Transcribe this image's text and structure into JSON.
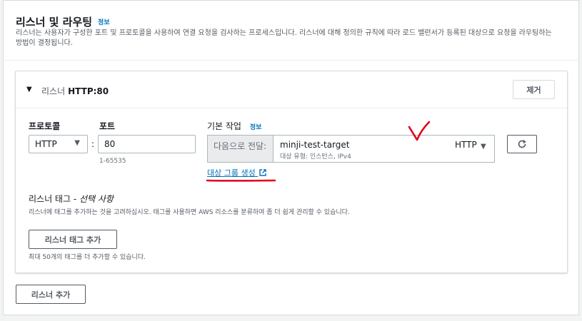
{
  "section": {
    "title": "리스너 및 라우팅",
    "info": "정보",
    "description": "리스너는 사용자가 구성한 포트 및 프로토콜을 사용하여 연결 요청을 검사하는 프로세스입니다. 리스너에 대해 정의한 규칙에 따라 로드 밸런서가 등록된 대상으로 요청을 라우팅하는 방법이 결정됩니다."
  },
  "listener": {
    "label": "리스너",
    "name": "HTTP:80",
    "remove_button": "제거",
    "protocol_label": "프로토콜",
    "protocol_value": "HTTP",
    "port_label": "포트",
    "port_value": "80",
    "port_hint": "1-65535",
    "default_action_label": "기본 작업",
    "default_action_info": "정보",
    "forward_prefix": "다음으로 전달:",
    "target_name": "minji-test-target",
    "target_sub": "대상 유형: 인스턴스, IPv4",
    "target_protocol": "HTTP",
    "create_target_link": "대상 그룹 생성",
    "tags_title": "리스너 태그 - ",
    "tags_optional": "선택 사항",
    "tags_desc": "리스너에 태그를 추가하는 것을 고려하십시오. 태그를 사용하면 AWS 리소스를 분류하여 좀 더 쉽게 관리할 수 있습니다.",
    "add_tag_button": "리스너 태그 추가",
    "tag_limit_hint": "최대 50개의 태그를 더 추가할 수 있습니다."
  },
  "add_listener_button": "리스너 추가",
  "colors": {
    "accent": "#0073bb",
    "annotation": "#e0001b"
  }
}
